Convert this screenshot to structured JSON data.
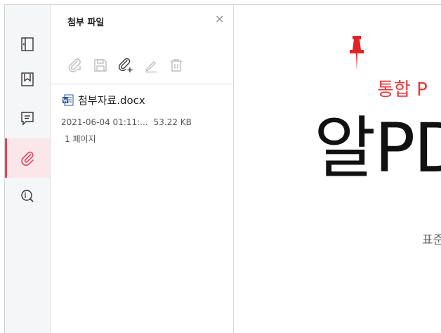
{
  "panel": {
    "title": "첨부 파일",
    "close": "×"
  },
  "attachment": {
    "file_name": "첨부자료.docx",
    "modified": "2021-06-04 01:11:...",
    "size": "53.22 KB",
    "pages": "1 페이지"
  },
  "document": {
    "subtitle": "통합 P",
    "title": "알PD",
    "small_text": "표준"
  },
  "rail": {
    "items": [
      "thumbnails-icon",
      "bookmark-icon",
      "comment-icon",
      "attachment-icon",
      "search-icon"
    ],
    "active": "attachment-icon"
  },
  "toolbar": [
    "open-attachment-icon",
    "save-attachment-icon",
    "add-attachment-icon",
    "edit-description-icon",
    "delete-attachment-icon"
  ],
  "colors": {
    "accent": "#e2475a",
    "doc_red": "#e33a3a",
    "rail_bg": "#f5f6f8"
  }
}
